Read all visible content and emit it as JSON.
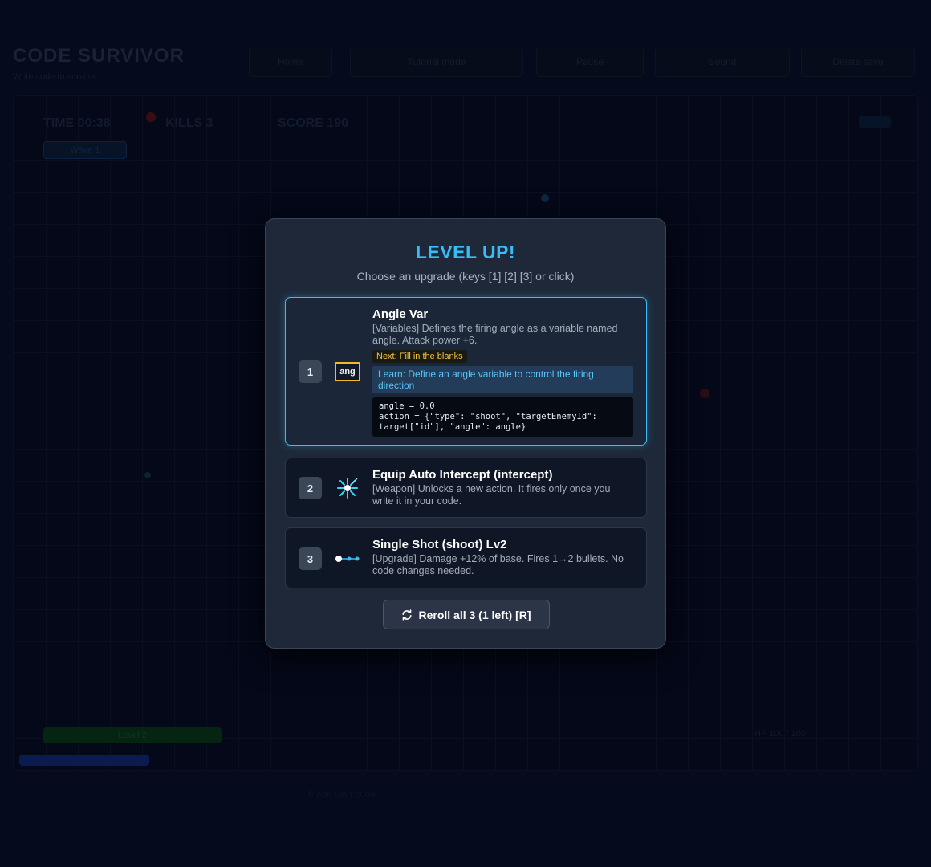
{
  "background": {
    "game_title": "CODE SURVIVOR",
    "game_subtitle": "Write code to survive",
    "buttons": [
      "Home",
      "Tutorial mode",
      "Pause",
      "Sound",
      "Delete save"
    ],
    "hud": {
      "time": "TIME 00:38",
      "kills": "KILLS 3",
      "score": "SCORE 190",
      "tag": "Wave 1"
    },
    "bar_label": "Level 2",
    "right_label": "HP 100 / 100",
    "footer_text": "Made with code"
  },
  "modal": {
    "title": "LEVEL UP!",
    "subtitle": "Choose an upgrade (keys [1] [2] [3] or click)",
    "options": [
      {
        "key": "1",
        "icon": "ang",
        "icon_name": "angle-variable-icon",
        "name": "Angle Var",
        "desc": "[Variables] Defines the firing angle as a variable named angle. Attack power +6.",
        "badge": "Next: Fill in the blanks",
        "learn": "Learn: Define an angle variable to control the firing direction",
        "code": [
          "angle = 0.0",
          "action = {\"type\": \"shoot\", \"targetEnemyId\":",
          "target[\"id\"], \"angle\": angle}"
        ]
      },
      {
        "key": "2",
        "icon_name": "intercept-burst-icon",
        "name": "Equip Auto Intercept (intercept)",
        "desc": "[Weapon] Unlocks a new action. It fires only once you write it in your code."
      },
      {
        "key": "3",
        "icon_name": "single-shot-icon",
        "name": "Single Shot (shoot) Lv2",
        "desc": "[Upgrade] Damage +12% of base. Fires 1→2 bullets. No code changes needed."
      }
    ],
    "reroll_label": "Reroll all 3 (1 left) [R]",
    "colors": {
      "accent": "#38bdf8",
      "badge": "#f5c542",
      "panel": "#1e2838"
    }
  }
}
